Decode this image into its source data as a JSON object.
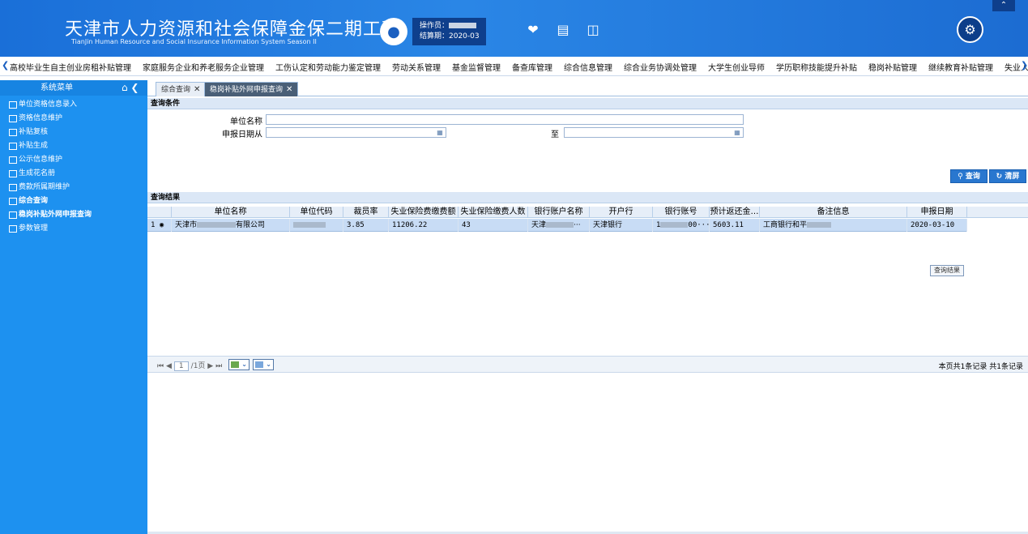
{
  "header": {
    "title_cn": "天津市人力资源和社会保障金保二期工程",
    "title_en": "TianJin Human Resource and Social Insurance Information System Season II",
    "operator_label": "操作员：",
    "period_label": "结算期：2020-03",
    "icons": [
      "user-icon",
      "heart-icon",
      "card-icon",
      "book-icon",
      "gear-icon",
      "chevron-up-icon"
    ]
  },
  "module_nav": {
    "items": [
      "高校毕业生自主创业房租补贴管理",
      "家庭服务企业和养老服务企业管理",
      "工伤认定和劳动能力鉴定管理",
      "劳动关系管理",
      "基金监督管理",
      "备查库管理",
      "综合信息管理",
      "综合业务协调处管理",
      "大学生创业导师",
      "学历职称技能提升补贴",
      "稳岗补贴管理",
      "继续教育补贴管理",
      "失业人"
    ]
  },
  "sidebar": {
    "title": "系统菜单",
    "items": [
      {
        "label": "单位资格信息录入",
        "bold": false
      },
      {
        "label": "资格信息维护",
        "bold": false
      },
      {
        "label": "补贴复核",
        "bold": false
      },
      {
        "label": "补贴生成",
        "bold": false
      },
      {
        "label": "公示信息维护",
        "bold": false
      },
      {
        "label": "生成花名册",
        "bold": false
      },
      {
        "label": "费款所属期维护",
        "bold": false
      },
      {
        "label": "综合查询",
        "bold": true
      },
      {
        "label": "稳岗补贴外网申报查询",
        "bold": true
      },
      {
        "label": "参数管理",
        "bold": false
      }
    ]
  },
  "tabs": [
    {
      "label": "综合查询"
    },
    {
      "label": "稳岗补贴外网申报查询"
    }
  ],
  "query": {
    "section_title": "查询条件",
    "unit_name_label": "单位名称",
    "date_from_label": "申报日期从",
    "date_to_label": "至",
    "unit_name_value": "",
    "date_from_value": "",
    "date_to_value": "",
    "search_label": "查询",
    "clear_label": "清屏"
  },
  "results": {
    "section_title": "查询结果",
    "columns": [
      "单位名称",
      "单位代码",
      "裁员率",
      "失业保险费缴费额",
      "失业保险缴费人数",
      "银行账户名称",
      "开户行",
      "银行账号",
      "预计返还金…",
      "备注信息",
      "申报日期"
    ],
    "rows": [
      {
        "index": "1",
        "unit_name_prefix": "天津市",
        "unit_name_suffix": "有限公司",
        "unit_code": "",
        "layoff_rate": "3.85",
        "fee_amount": "11206.22",
        "insured_count": "43",
        "account_name": "天津",
        "bank": "天津银行",
        "account_no_prefix": "1",
        "account_no_suffix": "00···",
        "refund": "5603.11",
        "remark": "工商银行和平",
        "date": "2020-03-10"
      }
    ],
    "result_button": "查询结果"
  },
  "pager": {
    "page": "1",
    "total_pages": "/1页",
    "summary": "本页共1条记录 共1条记录"
  }
}
